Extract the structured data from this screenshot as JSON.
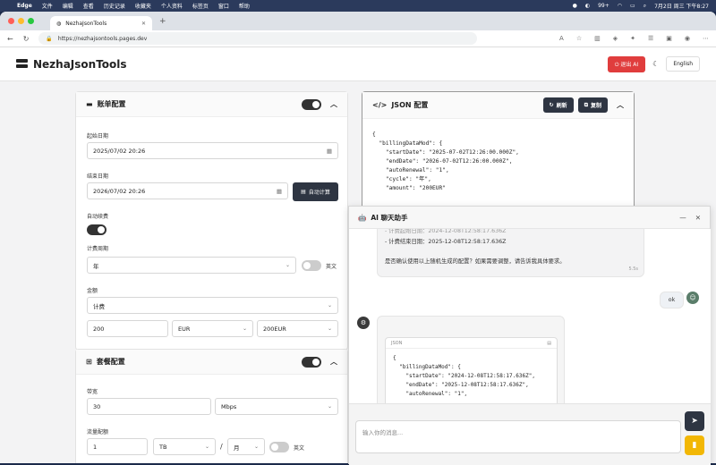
{
  "macbar": {
    "app": "Edge",
    "menus": [
      "文件",
      "编辑",
      "查看",
      "历史记录",
      "收藏夹",
      "个人资料",
      "标签页",
      "窗口",
      "帮助"
    ],
    "battery": "99+",
    "datetime": "7月2日 周三 下午8:27"
  },
  "browser": {
    "tab_title": "NezhaJsonTools",
    "url": "https://nezhajsontools.pages.dev"
  },
  "header": {
    "title": "NezhaJsonTools",
    "exit_ai": "退出 AI",
    "theme_icon": "moon-icon",
    "language": "English"
  },
  "billing": {
    "title": "账单配置",
    "start_label": "起始日期",
    "start_value": "2025/07/02 20:26",
    "end_label": "结束日期",
    "end_value": "2026/07/02 20:26",
    "auto_calc": "自动计算",
    "renew_label": "自动续费",
    "cycle_label": "计费周期",
    "cycle_value": "年",
    "cycle_lang": "英文",
    "amount_label": "金额",
    "amount_mode": "计费",
    "amount_value": "200",
    "currency": "EUR",
    "amount_combined": "200EUR"
  },
  "plan": {
    "title": "套餐配置",
    "bandwidth_label": "带宽",
    "bandwidth_value": "30",
    "bandwidth_unit": "Mbps",
    "traffic_label": "流量配额",
    "traffic_value": "1",
    "traffic_unit": "TB",
    "traffic_sep": "/",
    "traffic_period": "月",
    "traffic_lang": "英文"
  },
  "json_panel": {
    "title": "JSON 配置",
    "refresh": "刷新",
    "copy": "复制",
    "code": "{\n  \"billingDataMod\": {\n    \"startDate\": \"2025-07-02T12:26:00.000Z\",\n    \"endDate\": \"2026-07-02T12:26:00.000Z\",\n    \"autoRenewal\": \"1\",\n    \"cycle\": \"年\",\n    \"amount\": \"200EUR\""
  },
  "chat": {
    "title": "AI 聊天助手",
    "msg1_line1": "- 计费起始日期：2024-12-08T12:58:17.636Z",
    "msg1_line2": "- 计费结束日期：2025-12-08T12:58:17.636Z",
    "msg1_line3": "是否确认使用以上随机生成的配置？如果需要调整，请告诉我具体要求。",
    "msg1_time": "5.5s",
    "user_msg": "ok",
    "code_label": "JSON",
    "code": "{\n  \"billingDataMod\": {\n    \"startDate\": \"2024-12-08T12:58:17.636Z\",\n    \"endDate\": \"2025-12-08T12:58:17.636Z\",\n    \"autoRenewal\": \"1\",",
    "input_placeholder": "输入你的消息..."
  }
}
